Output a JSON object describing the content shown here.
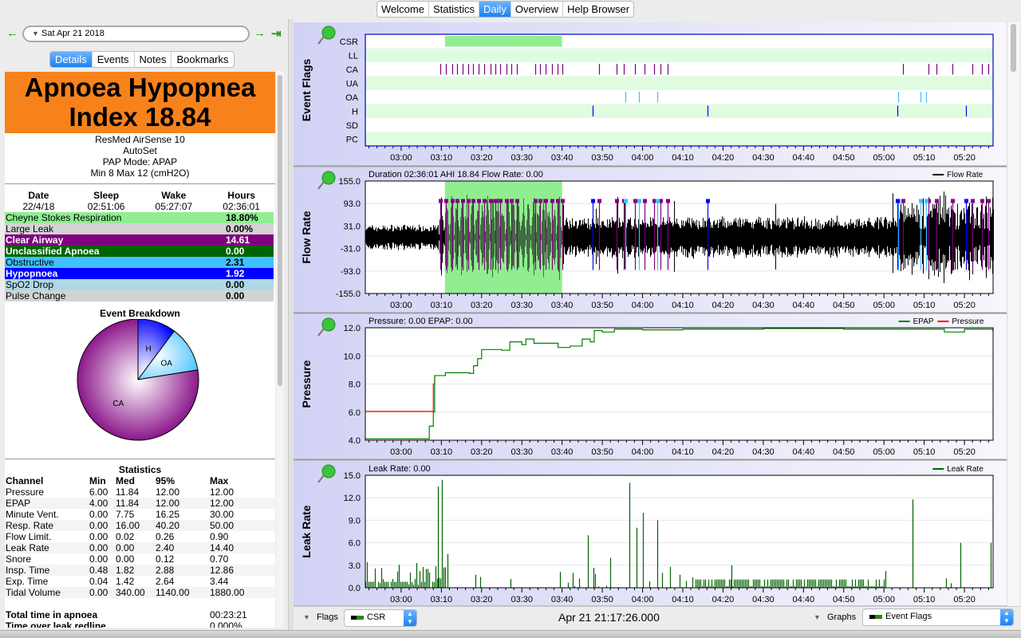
{
  "top_tabs": [
    "Welcome",
    "Statistics",
    "Daily",
    "Overview",
    "Help Browser"
  ],
  "active_tab": "Daily",
  "nav": {
    "date": "Sat Apr 21 2018"
  },
  "sub_tabs": [
    "Details",
    "Events",
    "Notes",
    "Bookmarks"
  ],
  "active_sub_tab": "Details",
  "details": {
    "ahi_line1": "Apnoea Hypopnea",
    "ahi_line2": "Index 18.84",
    "machine": "ResMed AirSense 10",
    "model": "AutoSet",
    "mode": "PAP Mode: APAP",
    "range": "Min 8 Max 12 (cmH2O)",
    "headers": [
      "Date",
      "Sleep",
      "Wake",
      "Hours"
    ],
    "values": [
      "22/4/18",
      "02:51:06",
      "05:27:07",
      "02:36:01"
    ],
    "indices": [
      {
        "name": "Cheyne Stokes Respiration",
        "value": "18.80%",
        "bg": "#90ee90",
        "fg": "#000000"
      },
      {
        "name": "Large Leak",
        "value": "0.00%",
        "bg": "#d3d3d3",
        "fg": "#000000"
      },
      {
        "name": "Clear Airway",
        "value": "14.61",
        "bg": "#800080",
        "fg": "#ffffff"
      },
      {
        "name": "Unclassified Apnoea",
        "value": "0.00",
        "bg": "#006400",
        "fg": "#ffffff"
      },
      {
        "name": "Obstructive",
        "value": "2.31",
        "bg": "#40c0ff",
        "fg": "#000000"
      },
      {
        "name": "Hypopnoea",
        "value": "1.92",
        "bg": "#0000ff",
        "fg": "#ffffff"
      },
      {
        "name": "SpO2 Drop",
        "value": "0.00",
        "bg": "#add8e6",
        "fg": "#000000"
      },
      {
        "name": "Pulse Change",
        "value": "0.00",
        "bg": "#d3d3d3",
        "fg": "#000000"
      }
    ],
    "breakdown": {
      "title": "Event Breakdown",
      "slices": [
        {
          "label": "H",
          "value": 1.92,
          "color": "#0000ff"
        },
        {
          "label": "OA",
          "value": 2.31,
          "color": "#40c0ff"
        },
        {
          "label": "CA",
          "value": 14.61,
          "color": "#800080"
        }
      ]
    },
    "statistics": {
      "title": "Statistics",
      "headers": [
        "Channel",
        "Min",
        "Med",
        "95%",
        "Max"
      ],
      "rows": [
        [
          "Pressure",
          "6.00",
          "11.84",
          "12.00",
          "12.00"
        ],
        [
          "EPAP",
          "4.00",
          "11.84",
          "12.00",
          "12.00"
        ],
        [
          "Minute Vent.",
          "0.00",
          "7.75",
          "16.25",
          "30.00"
        ],
        [
          "Resp. Rate",
          "0.00",
          "16.00",
          "40.20",
          "50.00"
        ],
        [
          "Flow Limit.",
          "0.00",
          "0.02",
          "0.26",
          "0.90"
        ],
        [
          "Leak Rate",
          "0.00",
          "0.00",
          "2.40",
          "14.40"
        ],
        [
          "Snore",
          "0.00",
          "0.00",
          "0.12",
          "0.70"
        ],
        [
          "Insp. Time",
          "0.48",
          "1.82",
          "2.88",
          "12.86"
        ],
        [
          "Exp. Time",
          "0.04",
          "1.42",
          "2.64",
          "3.44"
        ],
        [
          "Tidal Volume",
          "0.00",
          "340.00",
          "1140.00",
          "1880.00"
        ]
      ]
    },
    "totals": [
      [
        "Total time in apnoea",
        "00:23:21"
      ],
      [
        "Time over leak redline",
        "0.000%"
      ]
    ]
  },
  "chart_data": [
    {
      "type": "event-flags",
      "title": "Event Flags",
      "rows": [
        "CSR",
        "LL",
        "CA",
        "UA",
        "OA",
        "H",
        "SD",
        "PC"
      ],
      "x_range": [
        "02:51:06",
        "05:27:07"
      ],
      "x_ticks": [
        "03:00",
        "03:10",
        "03:20",
        "03:30",
        "03:40",
        "03:50",
        "04:00",
        "04:10",
        "04:20",
        "04:30",
        "04:40",
        "04:50",
        "05:00",
        "05:10",
        "05:20"
      ],
      "csr_spans": [
        [
          "03:10:54",
          "03:40:00"
        ]
      ],
      "events": {
        "CA": [
          "03:09:42",
          "03:11:06",
          "03:12:42",
          "03:13:54",
          "03:15:12",
          "03:16:36",
          "03:17:48",
          "03:19:12",
          "03:20:36",
          "03:22:12",
          "03:23:24",
          "03:24:36",
          "03:26:06",
          "03:27:18",
          "03:28:42",
          "03:33:18",
          "03:34:30",
          "03:36:00",
          "03:37:24",
          "03:38:48",
          "03:40:00",
          "03:49:06",
          "03:53:30",
          "03:55:24",
          "03:58:12",
          "04:00:24",
          "04:02:48",
          "04:04:24",
          "04:06:18",
          "05:04:48",
          "05:11:06",
          "05:13:06",
          "05:17:00",
          "05:22:00",
          "05:24:24",
          "05:25:54"
        ],
        "OA": [
          "03:55:48",
          "03:59:00",
          "04:03:36",
          "05:03:36",
          "05:09:06",
          "05:10:30"
        ],
        "H": [
          "03:47:30",
          "04:16:12",
          "05:03:24",
          "05:20:24"
        ]
      },
      "colors": {
        "CSR": "#90ee90",
        "CA": "#800080",
        "OA": "#40c0ff",
        "H": "#0000ff"
      }
    },
    {
      "type": "line",
      "title": "Flow Rate",
      "header": "Duration 02:36:01 AHI 18.84 Flow Rate: 0.00",
      "legend": [
        "Flow Rate"
      ],
      "y_ticks": [
        "155.0",
        "93.0",
        "31.0",
        "-31.0",
        "-93.0",
        "-155.0"
      ],
      "ylim": [
        -155,
        155
      ]
    },
    {
      "type": "line",
      "title": "Pressure",
      "header": "Pressure: 0.00 EPAP: 0.00",
      "legend": [
        "EPAP",
        "Pressure"
      ],
      "y_ticks": [
        "12.0",
        "10.0",
        "8.0",
        "6.0",
        "4.0"
      ],
      "ylim": [
        4,
        12
      ],
      "series": [
        {
          "name": "Pressure",
          "color": "#ff0000",
          "points": [
            [
              "02:51:06",
              6.05
            ],
            [
              "03:06:00",
              6.05
            ],
            [
              "03:08:00",
              8.0
            ],
            [
              "03:08:20",
              8.6
            ]
          ]
        },
        {
          "name": "EPAP",
          "color": "#008000",
          "points": [
            [
              "02:51:06",
              4.1
            ],
            [
              "03:06:00",
              4.1
            ],
            [
              "03:07:00",
              5.0
            ],
            [
              "03:08:00",
              6.0
            ],
            [
              "03:08:20",
              8.6
            ],
            [
              "03:10:00",
              8.6
            ],
            [
              "03:11:00",
              8.8
            ],
            [
              "03:17:00",
              8.75
            ],
            [
              "03:18:00",
              9.3
            ],
            [
              "03:19:00",
              9.8
            ],
            [
              "03:20:00",
              10.45
            ],
            [
              "03:25:00",
              10.4
            ],
            [
              "03:27:00",
              11.0
            ],
            [
              "03:30:00",
              10.8
            ],
            [
              "03:31:00",
              11.2
            ],
            [
              "03:33:00",
              10.9
            ],
            [
              "03:39:00",
              10.6
            ],
            [
              "03:42:00",
              10.7
            ],
            [
              "03:45:00",
              11.2
            ],
            [
              "03:47:00",
              11.0
            ],
            [
              "03:48:00",
              11.8
            ],
            [
              "03:50:00",
              11.7
            ],
            [
              "03:53:00",
              11.9
            ],
            [
              "04:00:00",
              11.85
            ],
            [
              "04:10:00",
              11.9
            ],
            [
              "04:30:00",
              11.95
            ],
            [
              "04:50:00",
              11.9
            ],
            [
              "05:10:00",
              11.9
            ],
            [
              "05:15:00",
              11.7
            ],
            [
              "05:20:00",
              11.9
            ],
            [
              "05:27:07",
              11.7
            ]
          ]
        }
      ]
    },
    {
      "type": "line",
      "title": "Leak Rate",
      "header": "Leak Rate: 0.00",
      "legend": [
        "Leak Rate"
      ],
      "y_ticks": [
        "15.0",
        "12.0",
        "9.0",
        "6.0",
        "3.0",
        "0.0"
      ],
      "ylim": [
        0,
        15
      ],
      "color": "#006400",
      "spikes": [
        [
          "03:09:10",
          13.5
        ],
        [
          "03:10:10",
          14.4
        ],
        [
          "03:11:30",
          4.5
        ],
        [
          "03:46:30",
          7.0
        ],
        [
          "03:52:00",
          4.0
        ],
        [
          "03:56:40",
          14.0
        ],
        [
          "03:58:30",
          8.0
        ],
        [
          "04:00:10",
          10.0
        ],
        [
          "04:03:40",
          9.0
        ],
        [
          "04:22:00",
          3.0
        ],
        [
          "05:07:00",
          11.8
        ],
        [
          "05:19:00",
          6.0
        ],
        [
          "05:26:30",
          6.0
        ]
      ]
    }
  ],
  "bottom": {
    "flags_label": "Flags",
    "flags_value": "CSR",
    "timestamp": "Apr 21 21:17:26.000",
    "graphs_label": "Graphs",
    "graphs_value": "Event Flags"
  }
}
